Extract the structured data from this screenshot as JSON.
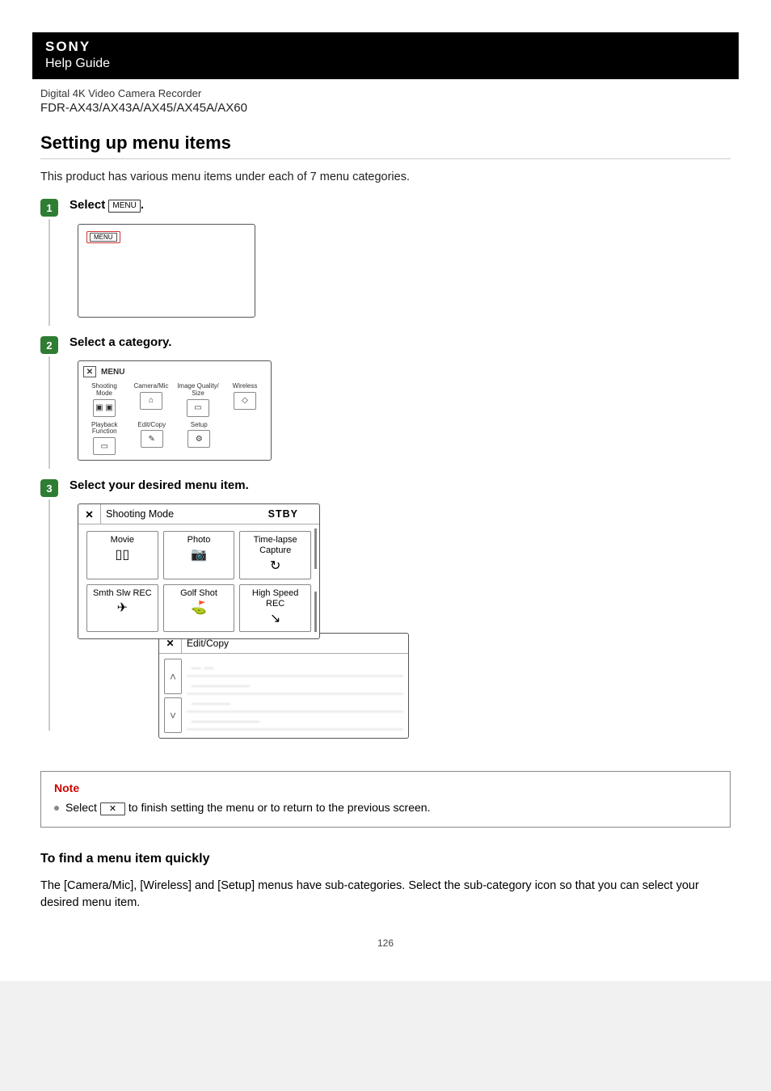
{
  "brand": "SONY",
  "help_guide": "Help Guide",
  "product_line": "Digital 4K Video Camera Recorder",
  "model_line": "FDR-AX43/AX43A/AX45/AX45A/AX60",
  "title": "Setting up menu items",
  "intro": "This product has various menu items under each of 7 menu categories.",
  "menu_label": "MENU",
  "steps": {
    "s1": {
      "num": "1",
      "title_pre": "Select ",
      "title_post": "."
    },
    "s2": {
      "num": "2",
      "title": "Select a category.",
      "categories_row1": [
        {
          "label": "Shooting Mode",
          "icon": "▣ ▣"
        },
        {
          "label": "Camera/Mic",
          "icon": "⌂"
        },
        {
          "label": "Image Quality/\nSize",
          "icon": "▭"
        },
        {
          "label": "Wireless",
          "icon": "◇"
        }
      ],
      "categories_row2": [
        {
          "label": "Playback\nFunction",
          "icon": "▭"
        },
        {
          "label": "Edit/Copy",
          "icon": "✎"
        },
        {
          "label": "Setup",
          "icon": "⚙"
        }
      ]
    },
    "s3": {
      "num": "3",
      "title": "Select your desired menu item.",
      "shoot_title": "Shooting Mode",
      "stby": "STBY",
      "modes": [
        {
          "label": "Movie",
          "icon": "▯▯"
        },
        {
          "label": "Photo",
          "icon": "📷"
        },
        {
          "label": "Time-lapse\nCapture",
          "icon": "↻"
        },
        {
          "label": "Smth Slw REC",
          "icon": "✈"
        },
        {
          "label": "Golf Shot",
          "icon": "⛳"
        },
        {
          "label": "High Speed REC",
          "icon": "↘"
        }
      ],
      "edit_title": "Edit/Copy",
      "edit_rows": [
        "— —",
        "——————",
        "————",
        "———————"
      ]
    }
  },
  "note": {
    "title": "Note",
    "pre": "Select ",
    "x": "✕",
    "post": " to finish setting the menu or to return to the previous screen."
  },
  "sub_title": "To find a menu item quickly",
  "sub_para": "The [Camera/Mic], [Wireless] and [Setup] menus have sub-categories. Select the sub-category icon so that you can select your desired menu item.",
  "page_number": "126"
}
